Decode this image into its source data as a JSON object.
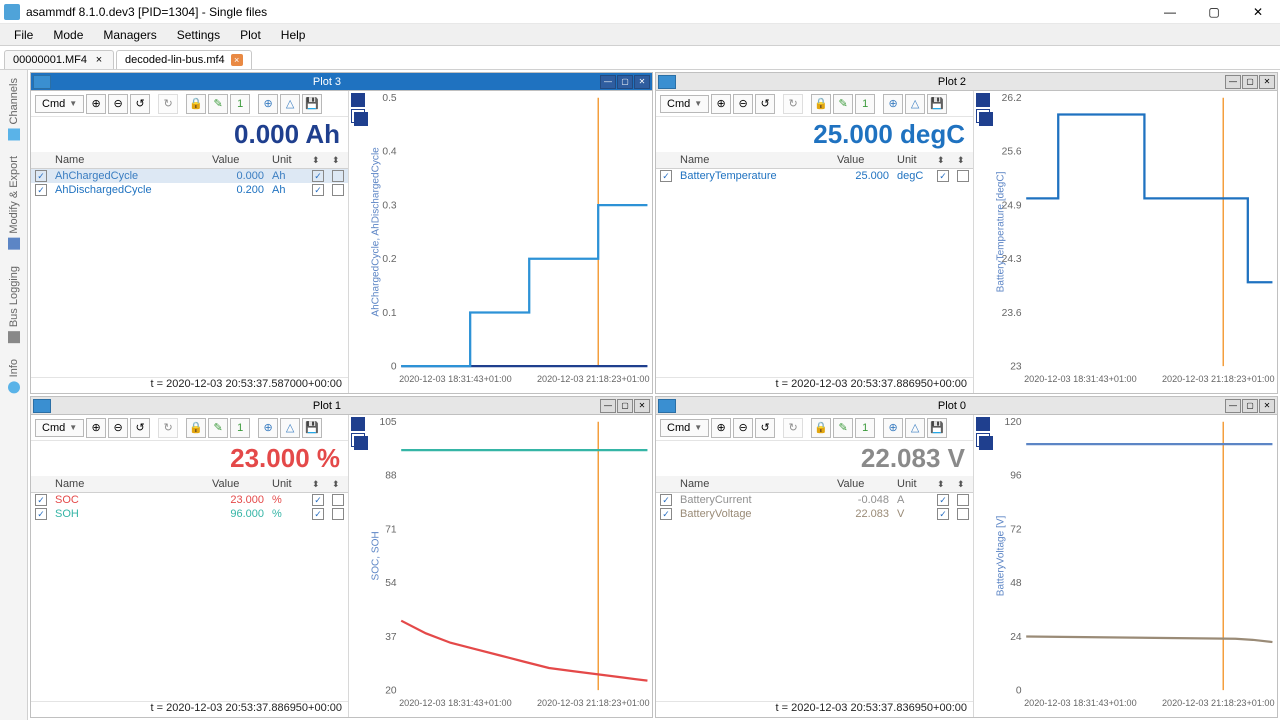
{
  "window": {
    "title": "asammdf 8.1.0.dev3 [PID=1304] - Single files"
  },
  "menu": [
    "File",
    "Mode",
    "Managers",
    "Settings",
    "Plot",
    "Help"
  ],
  "tabs": [
    {
      "label": "00000001.MF4",
      "active": false
    },
    {
      "label": "decoded-lin-bus.mf4",
      "active": true
    }
  ],
  "sidebar": [
    "Channels",
    "Modify & Export",
    "Bus Logging",
    "Info"
  ],
  "toolbar": {
    "cmd": "Cmd"
  },
  "plots": {
    "p3": {
      "title": "Plot 3",
      "big_value": "0.000 Ah",
      "status": "t = 2020-12-03 20:53:37.587000+00:00",
      "headers": [
        "Name",
        "Value",
        "Unit"
      ],
      "signals": [
        {
          "name": "AhChargedCycle",
          "value": "0.000",
          "unit": "Ah",
          "cls": "blue",
          "sel": true
        },
        {
          "name": "AhDischargedCycle",
          "value": "0.200",
          "unit": "Ah",
          "cls": "blue2"
        }
      ]
    },
    "p2": {
      "title": "Plot 2",
      "big_value": "25.000 degC",
      "status": "t = 2020-12-03 20:53:37.886950+00:00",
      "headers": [
        "Name",
        "Value",
        "Unit"
      ],
      "signals": [
        {
          "name": "BatteryTemperature",
          "value": "25.000",
          "unit": "degC",
          "cls": "blue2"
        }
      ]
    },
    "p1": {
      "title": "Plot 1",
      "big_value": "23.000 %",
      "status": "t = 2020-12-03 20:53:37.886950+00:00",
      "headers": [
        "Name",
        "Value",
        "Unit"
      ],
      "signals": [
        {
          "name": "SOC",
          "value": "23.000",
          "unit": "%",
          "cls": "red"
        },
        {
          "name": "SOH",
          "value": "96.000",
          "unit": "%",
          "cls": "teal"
        }
      ]
    },
    "p0": {
      "title": "Plot 0",
      "big_value": "22.083 V",
      "status": "t = 2020-12-03 20:53:37.836950+00:00",
      "headers": [
        "Name",
        "Value",
        "Unit"
      ],
      "signals": [
        {
          "name": "BatteryCurrent",
          "value": "-0.048",
          "unit": "A",
          "cls": "gray"
        },
        {
          "name": "BatteryVoltage",
          "value": "22.083",
          "unit": "V",
          "cls": "gbrown"
        }
      ]
    }
  },
  "axis_x_ticks": [
    "2020-12-03 18:31:43+01:00",
    "2020-12-03 21:18:23+01:00"
  ],
  "chart_data": [
    {
      "plot": "Plot 3",
      "type": "line",
      "xlabel": "time",
      "ylabel": "AhChargedCycle, AhDischargedCycle",
      "ylim": [
        0,
        0.5
      ],
      "x_ticks": [
        "2020-12-03 18:31:43+01:00",
        "2020-12-03 21:18:23+01:00"
      ],
      "cursor_x": "2020-12-03 21:18:23+01:00",
      "series": [
        {
          "name": "AhChargedCycle",
          "color": "#1f3f8e",
          "values": [
            [
              0,
              0
            ],
            [
              1,
              0
            ]
          ]
        },
        {
          "name": "AhDischargedCycle",
          "color": "#2d92d6",
          "step": true,
          "values": [
            [
              0,
              0
            ],
            [
              0.28,
              0
            ],
            [
              0.28,
              0.1
            ],
            [
              0.52,
              0.1
            ],
            [
              0.52,
              0.2
            ],
            [
              0.8,
              0.2
            ],
            [
              0.8,
              0.3
            ],
            [
              1,
              0.3
            ]
          ]
        }
      ]
    },
    {
      "plot": "Plot 2",
      "type": "line",
      "xlabel": "time",
      "ylabel": "BatteryTemperature [degC]",
      "ylim": [
        23,
        26.2
      ],
      "x_ticks": [
        "2020-12-03 18:31:43+01:00",
        "2020-12-03 21:18:23+01:00"
      ],
      "cursor_x": "2020-12-03 21:18:23+01:00",
      "series": [
        {
          "name": "BatteryTemperature",
          "color": "#1f72c0",
          "step": true,
          "values": [
            [
              0,
              25
            ],
            [
              0.13,
              25
            ],
            [
              0.13,
              26
            ],
            [
              0.48,
              26
            ],
            [
              0.48,
              25
            ],
            [
              0.9,
              25
            ],
            [
              0.9,
              24
            ],
            [
              1,
              24
            ]
          ]
        }
      ]
    },
    {
      "plot": "Plot 1",
      "type": "line",
      "xlabel": "time",
      "ylabel": "SOC, SOH",
      "ylim": [
        20,
        105
      ],
      "x_ticks": [
        "2020-12-03 18:31:43+01:00",
        "2020-12-03 21:18:23+01:00"
      ],
      "cursor_x": "2020-12-03 21:18:23+01:00",
      "series": [
        {
          "name": "SOH",
          "color": "#35b5a6",
          "values": [
            [
              0,
              96
            ],
            [
              1,
              96
            ]
          ]
        },
        {
          "name": "SOC",
          "color": "#e44949",
          "values": [
            [
              0,
              42
            ],
            [
              0.1,
              38
            ],
            [
              0.2,
              35
            ],
            [
              0.3,
              33
            ],
            [
              0.4,
              31
            ],
            [
              0.5,
              29
            ],
            [
              0.6,
              27
            ],
            [
              0.7,
              26
            ],
            [
              0.8,
              25
            ],
            [
              0.9,
              24
            ],
            [
              1.0,
              23
            ]
          ]
        }
      ]
    },
    {
      "plot": "Plot 0",
      "type": "line",
      "xlabel": "time",
      "ylabel": "BatteryVoltage [V]",
      "ylim": [
        0,
        120
      ],
      "x_ticks": [
        "2020-12-03 18:31:43+01:00",
        "2020-12-03 21:18:23+01:00"
      ],
      "cursor_x": "2020-12-03 21:18:23+01:00",
      "series": [
        {
          "name": "BatteryCurrent",
          "color": "#5c85c5",
          "values": [
            [
              0,
              110
            ],
            [
              1,
              110
            ]
          ]
        },
        {
          "name": "BatteryVoltage",
          "color": "#9a8b77",
          "values": [
            [
              0,
              24
            ],
            [
              0.85,
              23
            ],
            [
              0.92,
              22.5
            ],
            [
              1,
              21.5
            ]
          ]
        }
      ]
    }
  ]
}
